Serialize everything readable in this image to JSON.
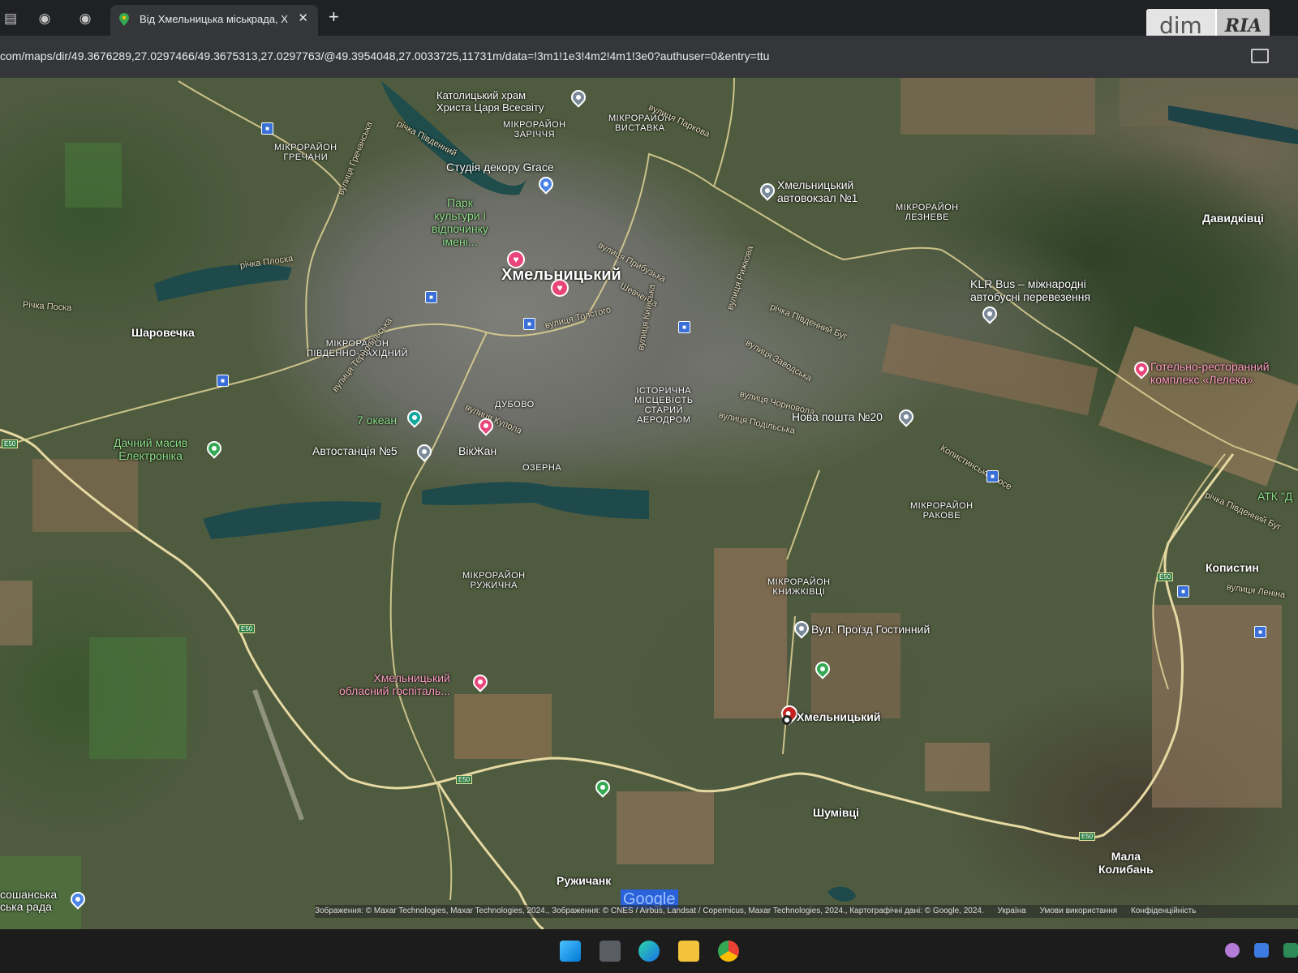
{
  "browser": {
    "tab": {
      "title": "Від Хмельницька міськрада, Х",
      "close_label": "✕"
    },
    "new_tab_label": "+",
    "url": "com/maps/dir/49.3676289,27.0297466/49.3675313,27.0297763/@49.3954048,27.0033725,11731m/data=!3m1!1e3!4m2!4m1!3e0?authuser=0&entry=ttu"
  },
  "watermark": {
    "dim": "dim",
    "ria": "RIA"
  },
  "map": {
    "labels": {
      "catholic_church": "Католицький храм\nХриста Царя Всесвіту",
      "zarichchia": "МІКРОРАЙОН\nЗАРІЧЧЯ",
      "vystavka": "МІКРОРАЙОН\nВИСТАВКА",
      "hrechany": "МІКРОРАЙОН\nГРЕЧАНИ",
      "river_pivdennyi": "річка Південний",
      "studio_grace": "Студія декору Grace",
      "park": "Парк\nкультури і\nвідпочинку\nімені...",
      "bus_station1": "Хмельницький\nавтовокзал №1",
      "lezneve": "МІКРОРАЙОН\nЛЕЗНЕВЕ",
      "davydkivtsi": "Давидківці",
      "river_ploska": "річка Плоска",
      "river_ploska2": "Річка Поска",
      "city": "Хмельницький",
      "klr_bus": "KLR Bus – міжнародні\nавтобусні перевезення",
      "sharovechka": "Шаровечка",
      "pivdenno_zakhidnyi": "МІКРОРАЙОН\nПІВДЕННО-ЗАХІДНИЙ",
      "river_pivdennyi_buh": "річка Південний Буг",
      "hotel_leleka": "Готельно-ресторанний\nкомплекс «Лелека»",
      "dubovo": "ДУБОВО",
      "historic_airfield": "ІСТОРИЧНА\nМІСЦЕВІСТЬ\nСТАРИЙ\nАЕРОДРОМ",
      "nova_poshta": "Нова пошта №20",
      "ocean7": "7 океан",
      "dachnyi": "Дачний масив\nЕлектроніка",
      "avtostantsiia5": "Автостанція №5",
      "vikzhan": "ВікЖан",
      "ozerna": "ОЗЕРНА",
      "rakove": "МІКРОРАЙОН\nРАКОВЕ",
      "atk": "АТК \"Д",
      "kopystyn": "Копистин",
      "ruzhychna": "МІКРОРАЙОН\nРУЖИЧНА",
      "knyzhkivtsi": "МІКРОРАЙОН\nКНИЖКІВЦІ",
      "proizd_hostynnyi": "Вул. Проїзд Гостинний",
      "hospital": "Хмельницький\nобласний госпіталь...",
      "destination": "Хмельницький",
      "shumivtsi": "Шумівці",
      "ruzhychanka": "Ружичанк",
      "mala_kolyban": "Мала\nКолибань",
      "council": "сошанська\nська рада",
      "street_pryburka": "вулиця Прибузька",
      "street_shevchenka": "Шевченка",
      "street_tolstoho": "вулиця Толстого",
      "street_zavodska": "вулиця Заводська",
      "street_chornovola": "вулиця Чорновола",
      "street_podilska": "вулиця Подільська",
      "street_kopystynske": "Копистинське шосе",
      "street_lenina": "вулиця Леніна",
      "street_hrechanyi": "вулиця Гречанська",
      "street_termal": "вулиця Тернопільська",
      "street_kupola": "вулиця Купола",
      "street_parkova": "вулиця Паркова",
      "street_ryzhkova": "вулиця Рижкова",
      "street_kyivska": "вулиця Київська",
      "street_pivdennyi_buh2": "річка Південний Буг"
    },
    "highway_shields": [
      "E50",
      "E50",
      "E50",
      "E50",
      "E50"
    ],
    "google_logo": "Google",
    "attribution": {
      "imagery": "Зображення: © Maxar Technologies, Maxar Technologies, 2024., Зображення: © CNES / Airbus, Landsat / Copernicus, Maxar Technologies, 2024., Картографічні дані: © Google, 2024.",
      "country": "Україна",
      "terms": "Умови використання",
      "privacy": "Конфіденційність"
    }
  },
  "colors": {
    "route": "#e6d9a2",
    "water": "#1f4a4c",
    "farmland": "#8a7358"
  }
}
